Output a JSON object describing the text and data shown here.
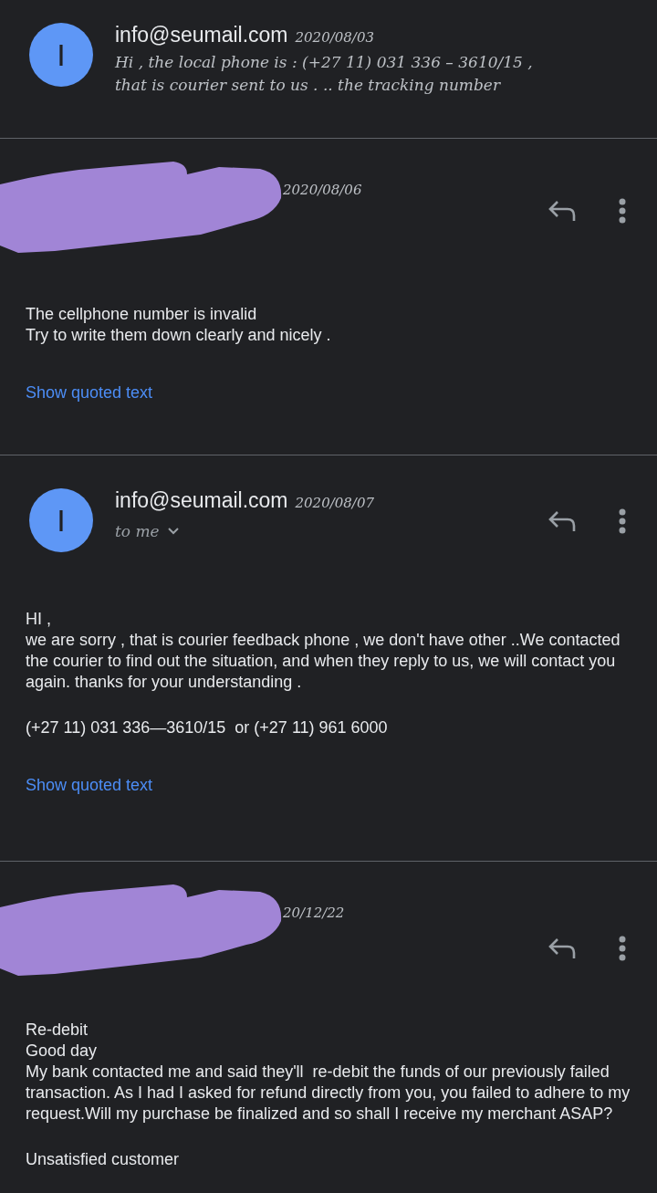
{
  "messages": [
    {
      "kind": "snippet",
      "redacted": false,
      "sender": "info@seumail.com",
      "avatar_letter": "I",
      "date": "2020/08/03",
      "snippet": "Hi , the local phone is : (+27 11) 031 336 – 3610/15 , that is courier sent to us . .. the tracking number"
    },
    {
      "kind": "expanded",
      "redacted": true,
      "date": "2020/08/06",
      "blocks": [
        [
          "The cellphone number is invalid",
          "Try to write them down clearly and nicely ."
        ]
      ],
      "quoted_link": "Show quoted text"
    },
    {
      "kind": "expanded",
      "redacted": false,
      "sender": "info@seumail.com",
      "avatar_letter": "I",
      "date": "2020/08/07",
      "to_line": "to me",
      "blocks": [
        [
          "HI ,",
          "we are sorry , that is courier feedback phone , we don't have other ..We contacted the courier to find out the situation, and when they reply to us, we will contact you again. thanks for your understanding ."
        ],
        [
          "(+27 11) 031 336—3610/15  or (+27 11) 961 6000"
        ]
      ],
      "quoted_link": "Show quoted text"
    },
    {
      "kind": "expanded",
      "redacted": true,
      "date": "20/12/22",
      "blocks": [
        [
          "Re-debit",
          "Good day",
          "My bank contacted me and said they'll  re-debit the funds of our previously failed transaction. As I had I asked for refund directly from you, you failed to adhere to my request.Will my purchase be finalized and so shall I receive my merchant ASAP?"
        ],
        [
          "Unsatisfied customer"
        ]
      ]
    }
  ]
}
